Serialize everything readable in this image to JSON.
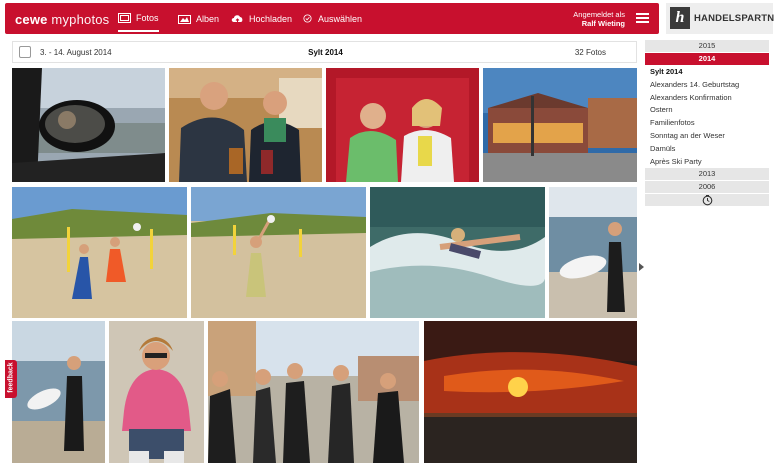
{
  "header": {
    "brand_bold": "cewe",
    "brand_light": " myphotos",
    "nav": [
      {
        "label": "Fotos",
        "icon": "photos-icon",
        "active": true
      },
      {
        "label": "Alben",
        "icon": "albums-icon",
        "active": false
      },
      {
        "label": "Hochladen",
        "icon": "upload-cloud-icon",
        "active": false
      },
      {
        "label": "Auswählen",
        "icon": "check-circle-icon",
        "active": false
      }
    ],
    "login_line1": "Angemeldet als",
    "login_user": "Ralf Wieting",
    "menu_icon": "hamburger-icon",
    "partner_letter": "h",
    "partner_text": "HANDELSPARTNER",
    "accent_color": "#c8102e"
  },
  "album": {
    "date_range": "3. - 14. August 2014",
    "title": "Sylt 2014",
    "photo_count": "32 Fotos"
  },
  "photos": [
    {
      "subject": "mirror-selfie-in-car"
    },
    {
      "subject": "two-men-in-restaurant"
    },
    {
      "subject": "boy-and-woman-red-wall"
    },
    {
      "subject": "seaside-promenade-buildings"
    },
    {
      "subject": "beach-volleyball-players"
    },
    {
      "subject": "beach-volleyball-jump"
    },
    {
      "subject": "bodyboarding-wave"
    },
    {
      "subject": "surfer-with-board"
    },
    {
      "subject": "surfer-walking-beach"
    },
    {
      "subject": "boy-pink-hoodie-sitting"
    },
    {
      "subject": "group-in-wetsuits"
    },
    {
      "subject": "sunset-over-sea"
    }
  ],
  "sidebar": {
    "years_top": [
      "2015",
      "2014"
    ],
    "albums": [
      "Sylt 2014",
      "Alexanders 14. Geburtstag",
      "Alexanders Konfirmation",
      "Ostern",
      "Familienfotos",
      "Sonntag an der Weser",
      "Damüls",
      "Après Ski Party"
    ],
    "years_bottom": [
      "2013",
      "2006"
    ],
    "clock_icon": "clock-icon"
  },
  "feedback_label": "feedback"
}
